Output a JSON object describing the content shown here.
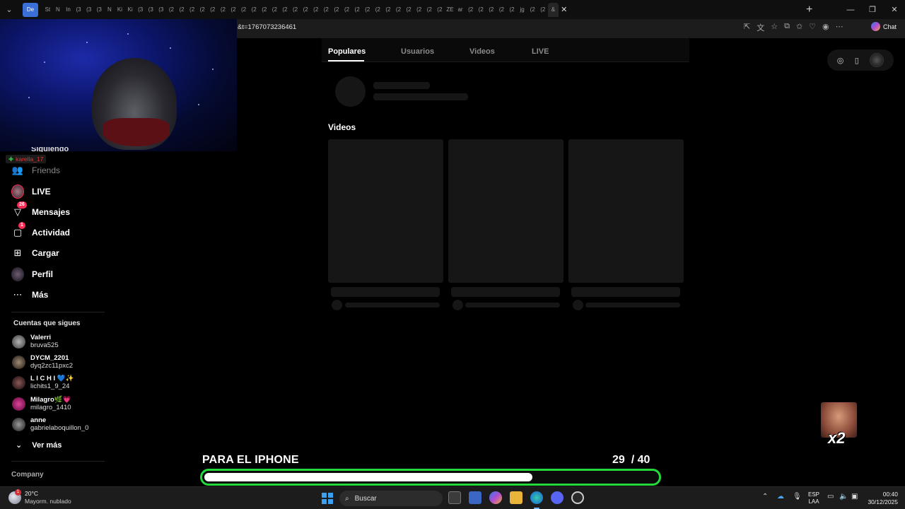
{
  "browser": {
    "first_tab": "De",
    "tab_labels": [
      "St",
      "N",
      "In",
      "(3",
      "(3",
      "(3",
      "N",
      "Ki",
      "Ki",
      "(3",
      "(3",
      "(3",
      "(2",
      "(2",
      "(2",
      "(2",
      "(2",
      "(2",
      "(2",
      "(2",
      "(2",
      "(2",
      "(2",
      "(2",
      "(2",
      "(2",
      "(2",
      "(2",
      "(2",
      "(2",
      "(2",
      "(2",
      "(2",
      "(2",
      "(2",
      "(2",
      "(2",
      "(2",
      "(2",
      "ZE",
      "ar",
      "(2",
      "(2",
      "(2",
      "(2",
      "(2",
      "jg",
      "(2",
      "(2"
    ],
    "active_tab": "&",
    "url": "&t=1767073236461",
    "chat_label": "Chat"
  },
  "sidebar": {
    "siguiendo_cut": "Siguiendo",
    "karella_tag": "karella_17",
    "items": [
      {
        "label": "Friends",
        "icon": "friends-icon",
        "dim": true
      },
      {
        "label": "LIVE",
        "icon": "live-avatar-icon"
      },
      {
        "label": "Mensajes",
        "icon": "messages-icon",
        "badge": "26"
      },
      {
        "label": "Actividad",
        "icon": "activity-icon",
        "badge": "1"
      },
      {
        "label": "Cargar",
        "icon": "upload-icon"
      },
      {
        "label": "Perfil",
        "icon": "profile-avatar-icon"
      },
      {
        "label": "Más",
        "icon": "more-icon"
      }
    ],
    "following_title": "Cuentas que sigues",
    "following": [
      {
        "name": "Valerri",
        "handle": "bruva525",
        "color": "#8a8a8a"
      },
      {
        "name": "DYCM_2201",
        "handle": "dyq2zc11pxc2",
        "color": "#6d5d50"
      },
      {
        "name": "L I C H I 💙✨",
        "handle": "lichits1_9_24",
        "color": "#5c3a3a"
      },
      {
        "name": "Milagro🌿💗",
        "handle": "milagro_1410",
        "color": "#c2277a"
      },
      {
        "name": "anne",
        "handle": "gabrielaboquillon_0",
        "color": "#777777"
      }
    ],
    "ver_mas": "Ver más",
    "company": "Company"
  },
  "search": {
    "tabs": [
      "Populares",
      "Usuarios",
      "Videos",
      "LIVE"
    ],
    "active_tab": "Populares",
    "videos_title": "Videos"
  },
  "overlay": {
    "goal_label": "PARA EL IPHONE",
    "goal_current": "29",
    "goal_total": "/ 40",
    "goal_progress": 0.725,
    "goal_color": "#23d93b",
    "multiplier": "x2"
  },
  "taskbar": {
    "temperature": "20°C",
    "weather": "Mayorm. nublado",
    "weather_badge": "1",
    "search_placeholder": "Buscar",
    "lang_top": "ESP",
    "lang_bottom": "LAA",
    "time": "00:40",
    "date": "30/12/2025"
  }
}
